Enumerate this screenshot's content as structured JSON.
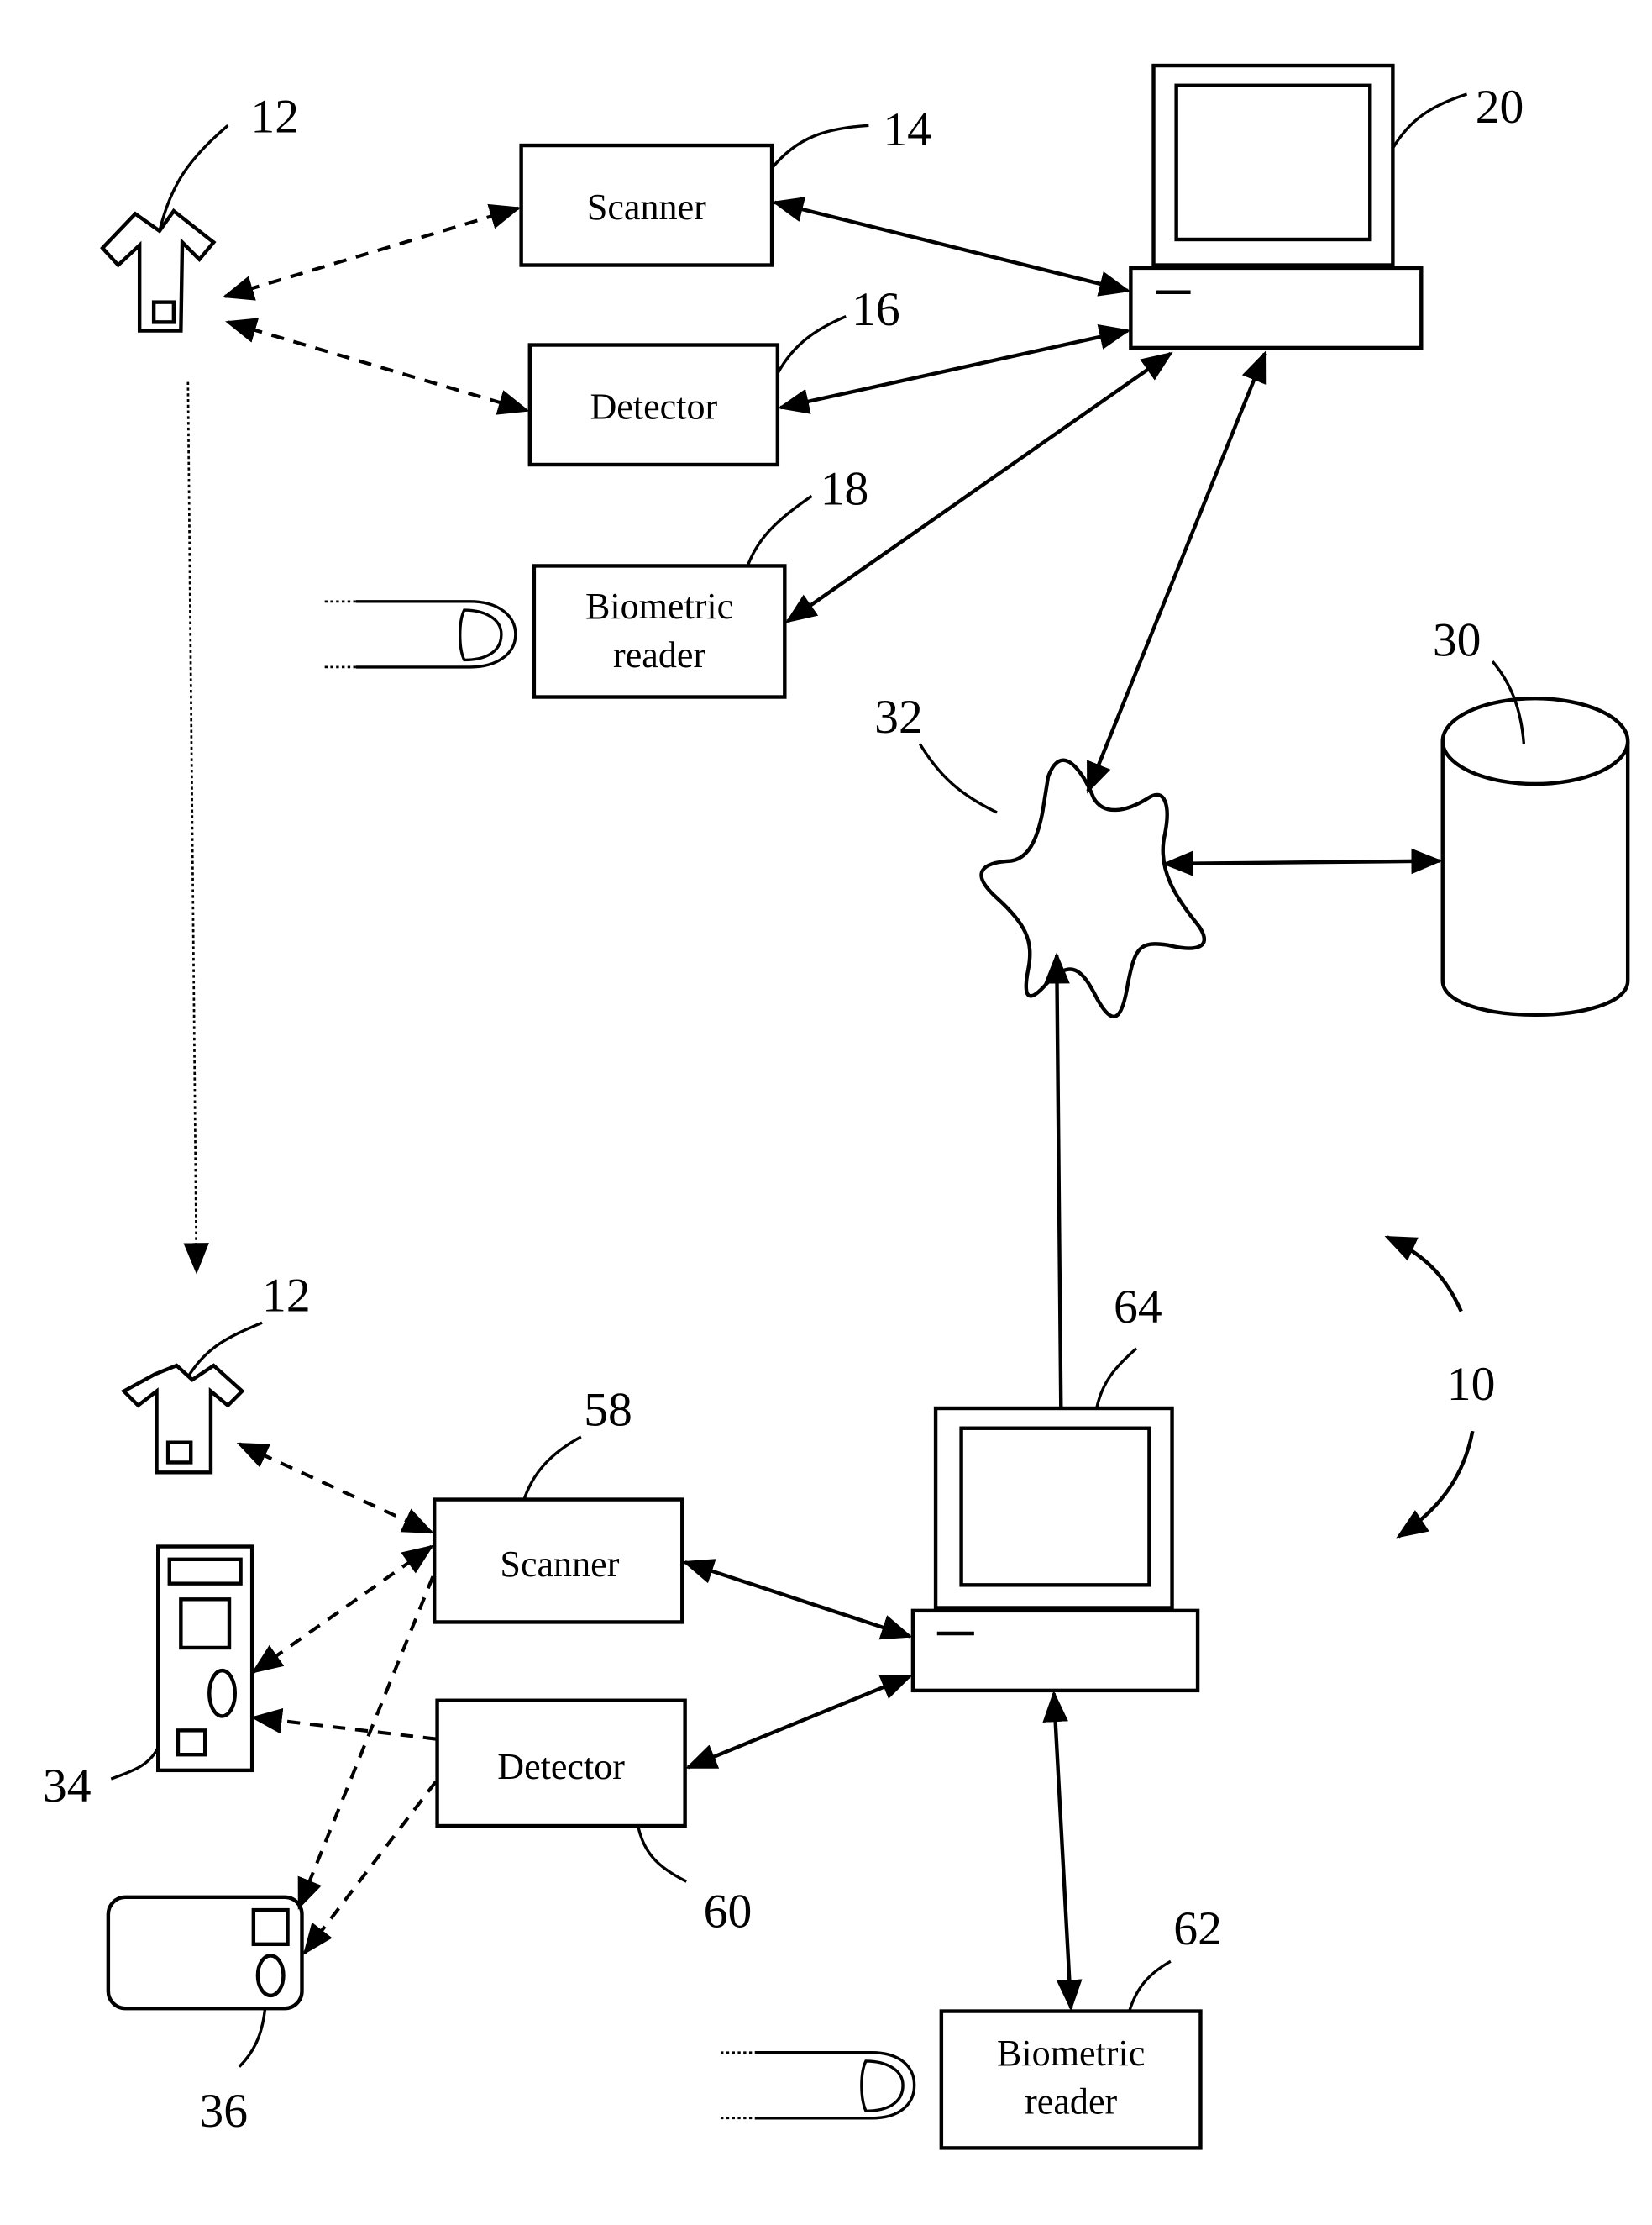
{
  "figure": {
    "system_ref": "10",
    "site_one": {
      "garment": {
        "ref": "12"
      },
      "scanner": {
        "ref": "14",
        "label": "Scanner"
      },
      "detector": {
        "ref": "16",
        "label": "Detector"
      },
      "biometric_reader": {
        "ref": "18",
        "label_line1": "Biometric",
        "label_line2": "reader"
      },
      "computer": {
        "ref": "20"
      }
    },
    "database": {
      "ref": "30"
    },
    "network": {
      "ref": "32"
    },
    "site_two": {
      "garment": {
        "ref": "12"
      },
      "handheld_device": {
        "ref": "34"
      },
      "portable_device": {
        "ref": "36"
      },
      "scanner": {
        "ref": "58",
        "label": "Scanner"
      },
      "detector": {
        "ref": "60",
        "label": "Detector"
      },
      "biometric_reader": {
        "ref": "62",
        "label_line1": "Biometric",
        "label_line2": "reader"
      },
      "computer": {
        "ref": "64"
      }
    },
    "connections": [
      {
        "from": "garment-12-top",
        "to": "scanner-14",
        "style": "dashed",
        "direction": "both"
      },
      {
        "from": "garment-12-top",
        "to": "detector-16",
        "style": "dashed",
        "direction": "both"
      },
      {
        "from": "scanner-14",
        "to": "computer-20",
        "style": "solid",
        "direction": "both"
      },
      {
        "from": "detector-16",
        "to": "computer-20",
        "style": "solid",
        "direction": "both"
      },
      {
        "from": "biometric-reader-18",
        "to": "computer-20",
        "style": "solid",
        "direction": "both"
      },
      {
        "from": "computer-20",
        "to": "network-32",
        "style": "solid",
        "direction": "both"
      },
      {
        "from": "network-32",
        "to": "database-30",
        "style": "solid",
        "direction": "both"
      },
      {
        "from": "computer-64",
        "to": "network-32",
        "style": "solid",
        "direction": "to"
      },
      {
        "from": "garment-12-top",
        "to": "garment-12-bottom",
        "style": "dotted",
        "direction": "to"
      },
      {
        "from": "garment-12-bottom",
        "to": "scanner-58",
        "style": "dashed",
        "direction": "both"
      },
      {
        "from": "scanner-58",
        "to": "handheld-device-34",
        "style": "dashed",
        "direction": "both"
      },
      {
        "from": "scanner-58",
        "to": "portable-device-36",
        "style": "dashed",
        "direction": "to"
      },
      {
        "from": "detector-60",
        "to": "handheld-device-34",
        "style": "dashed",
        "direction": "to"
      },
      {
        "from": "detector-60",
        "to": "portable-device-36",
        "style": "dashed",
        "direction": "to"
      },
      {
        "from": "scanner-58",
        "to": "computer-64",
        "style": "solid",
        "direction": "both"
      },
      {
        "from": "detector-60",
        "to": "computer-64",
        "style": "solid",
        "direction": "both"
      },
      {
        "from": "computer-64",
        "to": "biometric-reader-62",
        "style": "solid",
        "direction": "both"
      }
    ]
  }
}
